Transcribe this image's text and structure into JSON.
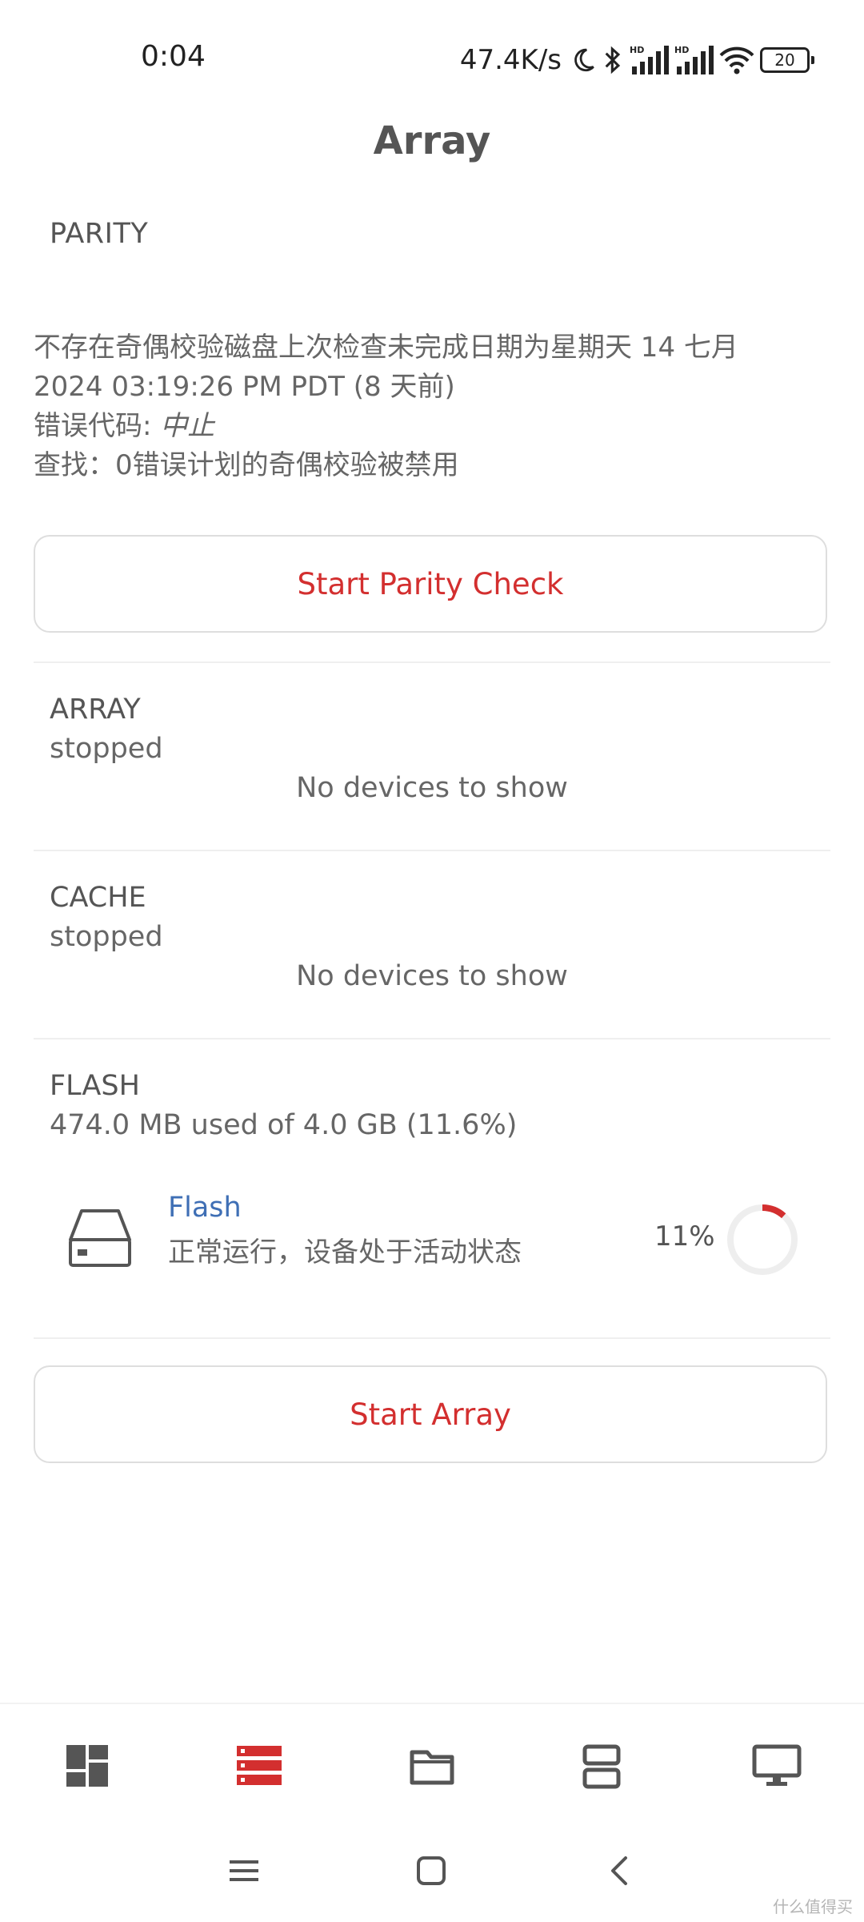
{
  "status": {
    "time": "0:04",
    "speed": "47.4K/s",
    "battery": "20"
  },
  "page": {
    "title": "Array"
  },
  "parity": {
    "label": "PARITY",
    "line1": "不存在奇偶校验磁盘上次检查未完成日期为星期天 14 七月",
    "line2": "2024 03:19:26 PM PDT (8 天前)",
    "error_prefix": "错误代码: ",
    "error_value": "中止",
    "line4": "查找：0错误计划的奇偶校验被禁用",
    "button": "Start Parity Check"
  },
  "array_section": {
    "title": "ARRAY",
    "state": "stopped",
    "empty": "No devices to show"
  },
  "cache_section": {
    "title": "CACHE",
    "state": "stopped",
    "empty": "No devices to show"
  },
  "flash_section": {
    "title": "FLASH",
    "usage": "474.0 MB used of 4.0 GB (11.6%)",
    "device": {
      "name": "Flash",
      "status": "正常运行，设备处于活动状态",
      "percent_label": "11%",
      "usage_fraction": 0.116
    }
  },
  "start_array_button": "Start Array",
  "bottom_nav": [
    {
      "icon": "dashboard-icon",
      "active": false
    },
    {
      "icon": "array-icon",
      "active": true
    },
    {
      "icon": "folder-icon",
      "active": false
    },
    {
      "icon": "shares-icon",
      "active": false
    },
    {
      "icon": "monitor-icon",
      "active": false
    }
  ],
  "colors": {
    "accent": "#d32f2f",
    "link": "#3f6fb5",
    "icon": "#555555",
    "ring_track": "#eeeeee"
  },
  "watermark": "什么值得买"
}
